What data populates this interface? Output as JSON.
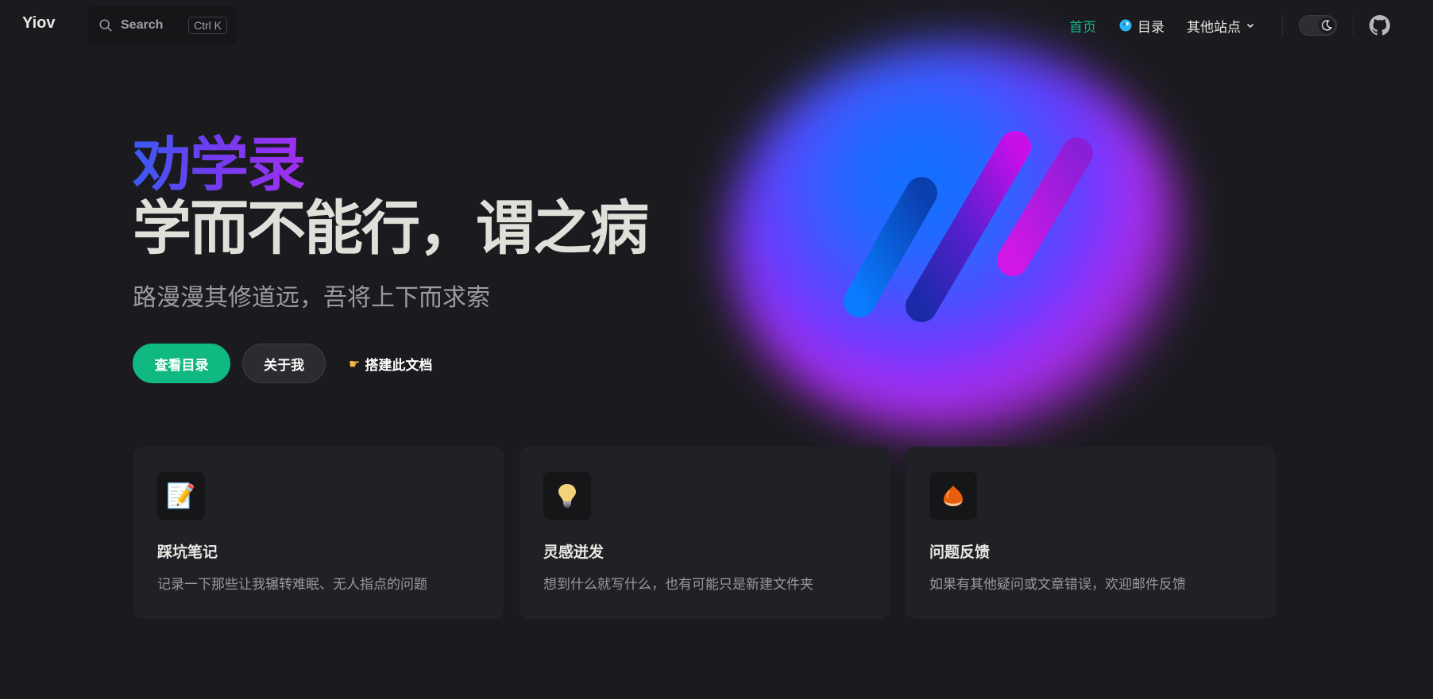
{
  "nav": {
    "brand": "Yiov",
    "search": {
      "label": "Search",
      "shortcut": "Ctrl K"
    },
    "links": [
      {
        "label": "首页",
        "active": true
      },
      {
        "label": "目录",
        "icon": "catalog-icon"
      },
      {
        "label": "其他站点",
        "dropdown": true
      }
    ],
    "theme_toggle": {
      "state": "dark",
      "icon": "moon-icon"
    },
    "social": {
      "icon": "github-icon"
    }
  },
  "hero": {
    "name": "劝学录",
    "text": "学而不能行，谓之病",
    "tagline": "路漫漫其修道远，吾将上下而求索",
    "actions": [
      {
        "label": "查看目录",
        "style": "brand"
      },
      {
        "label": "关于我",
        "style": "alt"
      },
      {
        "label": "搭建此文档",
        "style": "link",
        "icon": "pointing-hand-icon"
      }
    ]
  },
  "features": [
    {
      "icon": "memo-icon",
      "title": "踩坑笔记",
      "details": "记录一下那些让我辗转难眠、无人指点的问题"
    },
    {
      "icon": "light-bulb-icon",
      "title": "灵感迸发",
      "details": "想到什么就写什么，也有可能只是新建文件夹"
    },
    {
      "icon": "chestnut-icon",
      "title": "问题反馈",
      "details": "如果有其他疑问或文章错误，欢迎邮件反馈"
    }
  ],
  "colors": {
    "background": "#1b1b1f",
    "brand": "#10b981",
    "card": "#202127",
    "name_gradient": [
      "#3a5bf0",
      "#a12ff0"
    ]
  }
}
